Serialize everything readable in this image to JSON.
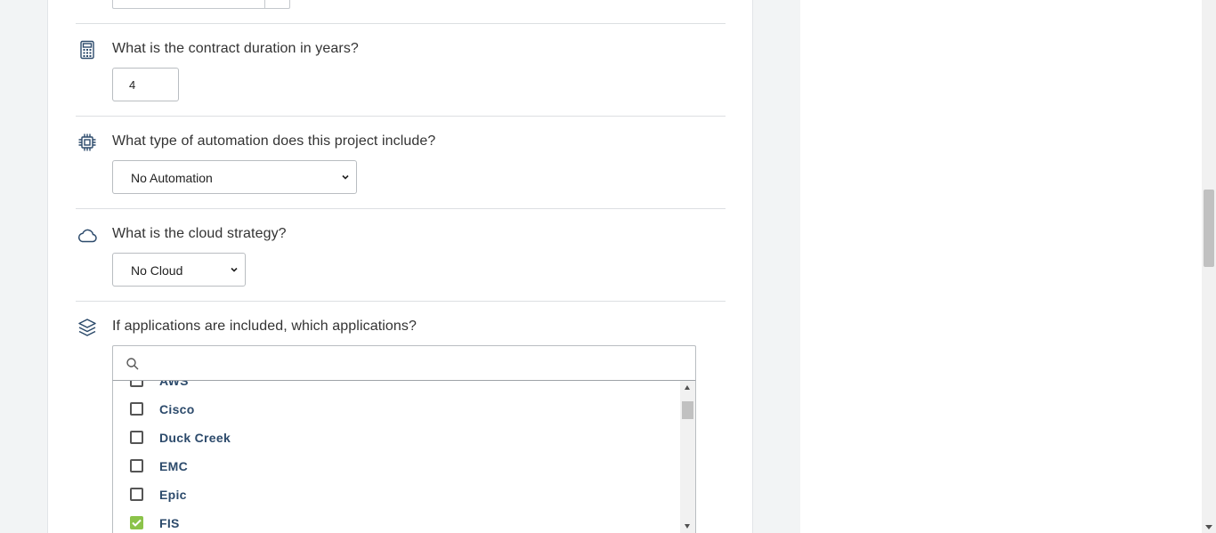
{
  "questions": {
    "contract_duration": {
      "label": "What is the contract duration in years?",
      "value": "4",
      "icon": "calculator-icon"
    },
    "automation": {
      "label": "What type of automation does this project include?",
      "selected": "No Automation",
      "icon": "chip-icon"
    },
    "cloud": {
      "label": "What is the cloud strategy?",
      "selected": "No Cloud",
      "icon": "cloud-icon"
    },
    "applications": {
      "label": "If applications are included, which applications?",
      "icon": "layers-icon",
      "search_placeholder": "",
      "options": [
        {
          "label": "AWS",
          "checked": false
        },
        {
          "label": "Cisco",
          "checked": false
        },
        {
          "label": "Duck Creek",
          "checked": false
        },
        {
          "label": "EMC",
          "checked": false
        },
        {
          "label": "Epic",
          "checked": false
        },
        {
          "label": "FIS",
          "checked": true
        }
      ]
    }
  },
  "colors": {
    "check_green": "#8bc34a",
    "option_text": "#2c4a6b",
    "icon_navy": "#2c4a6b"
  }
}
